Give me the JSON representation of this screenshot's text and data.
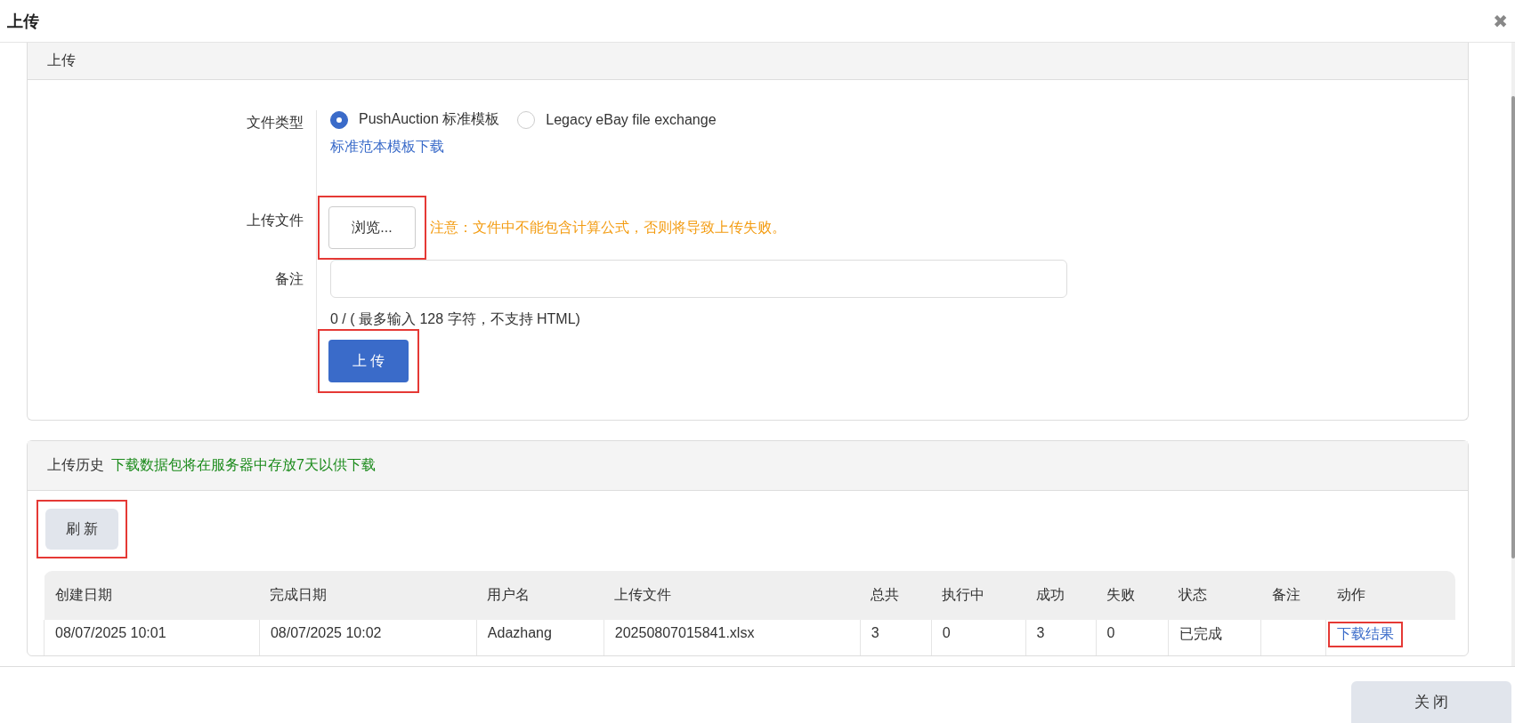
{
  "window": {
    "title": "上传",
    "close_label": "✖"
  },
  "upload_panel": {
    "title": "上传",
    "file_type": {
      "label": "文件类型",
      "options": [
        {
          "label": "PushAuction 标准模板",
          "selected": true
        },
        {
          "label": "Legacy eBay file exchange",
          "selected": false
        }
      ],
      "template_link": "标准范本模板下载"
    },
    "file": {
      "label": "上传文件",
      "browse": "浏览...",
      "browse_highlighted": true,
      "warning": "注意：文件中不能包含计算公式，否则将导致上传失败。"
    },
    "note": {
      "label": "备注",
      "counter": "0 / ( 最多输入 128 字符，不支持 HTML)"
    },
    "submit": {
      "label": "上 传",
      "highlighted": true
    }
  },
  "history_panel": {
    "title": "上传历史",
    "hint": "下载数据包将在服务器中存放7天以供下载",
    "refresh": {
      "label": "刷 新",
      "highlighted": true
    },
    "table": {
      "columns": [
        "创建日期",
        "完成日期",
        "用户名",
        "上传文件",
        "总共",
        "执行中",
        "成功",
        "失败",
        "状态",
        "备注",
        "动作"
      ],
      "rows": [
        {
          "cells": [
            "08/07/2025 10:01",
            "08/07/2025 10:02",
            "Adazhang",
            "20250807015841.xlsx",
            "3",
            "0",
            "3",
            "0",
            "已完成",
            ""
          ],
          "action": "下载结果",
          "action_highlighted": true
        }
      ]
    }
  },
  "footer": {
    "close": "关 闭"
  }
}
